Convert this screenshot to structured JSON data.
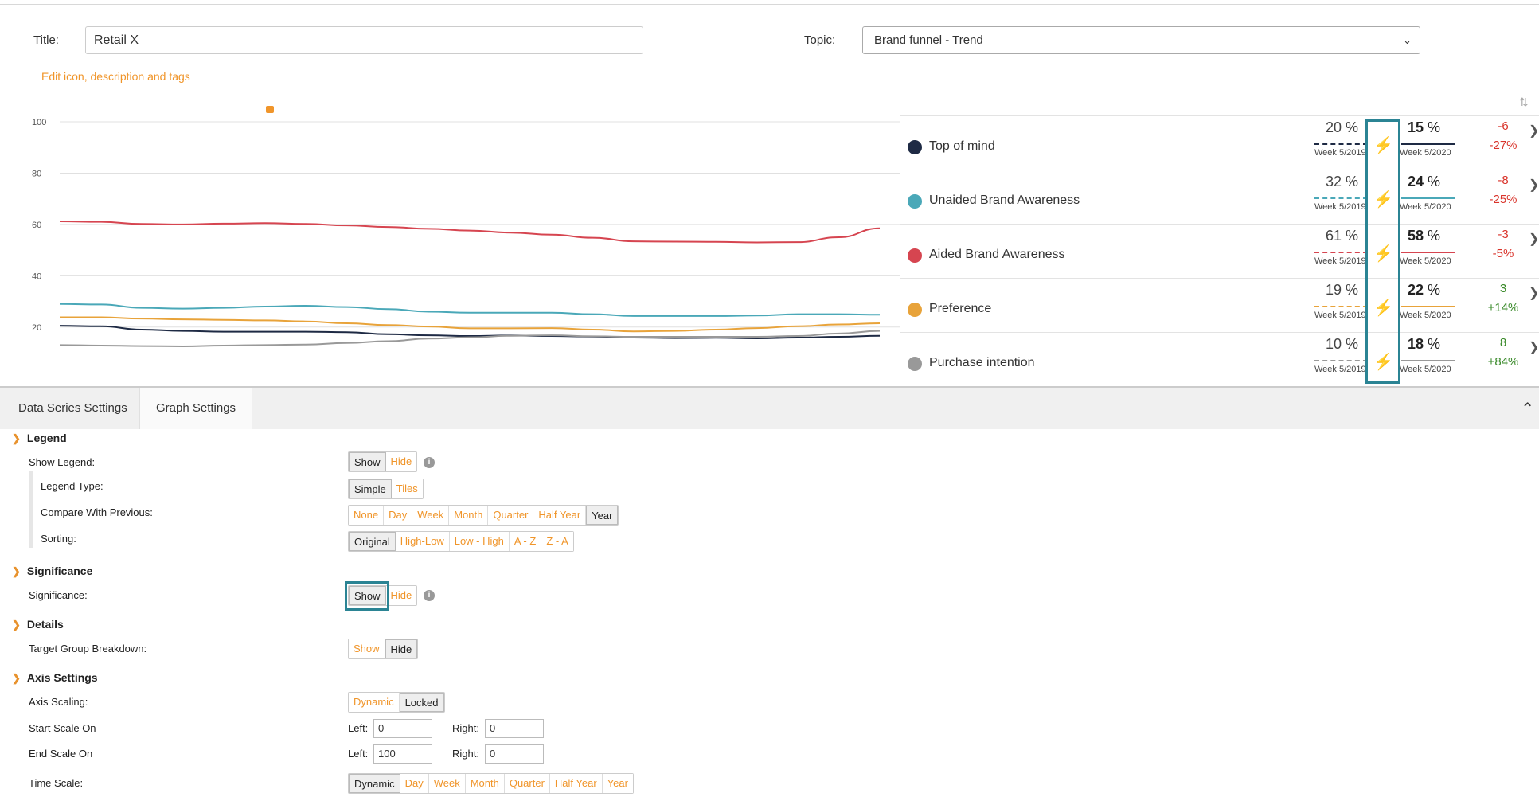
{
  "header": {
    "title_label": "Title:",
    "title_value": "Retail X",
    "topic_label": "Topic:",
    "topic_value": "Brand funnel - Trend",
    "edit_link": "Edit icon, description and tags"
  },
  "chart_data": {
    "type": "line",
    "ylim": [
      10,
      100
    ],
    "yticks": [
      "100",
      "80",
      "60",
      "40",
      "20"
    ],
    "x": [
      0,
      1,
      2,
      3,
      4,
      5,
      6,
      7,
      8,
      9,
      10,
      11,
      12,
      13,
      14,
      15,
      16,
      17,
      18,
      19,
      20
    ],
    "series": [
      {
        "name": "Aided Brand Awareness",
        "color": "#d64550",
        "values": [
          61.2,
          61,
          60.2,
          60,
          60.3,
          60.5,
          60.2,
          59.6,
          59,
          58.3,
          57.6,
          56.8,
          56,
          54.8,
          53.4,
          53.3,
          53.2,
          53,
          53.1,
          55,
          58.5
        ]
      },
      {
        "name": "Unaided Brand Awareness",
        "color": "#4aa8b8",
        "values": [
          29,
          28.8,
          27.5,
          27.2,
          27.5,
          28,
          28.3,
          27.8,
          27,
          26,
          25.6,
          25.6,
          25.6,
          25,
          24.3,
          24.3,
          24.3,
          24.5,
          25,
          25,
          24.8
        ]
      },
      {
        "name": "Preference",
        "color": "#e8a33a",
        "values": [
          23.8,
          23.8,
          23.3,
          23,
          22.8,
          22.6,
          22.2,
          21.5,
          20.8,
          20.2,
          19.5,
          19.5,
          19.6,
          19,
          18.3,
          18.5,
          19,
          19.6,
          20.3,
          21,
          21.5
        ]
      },
      {
        "name": "Top of mind",
        "color": "#1e2a44",
        "values": [
          20.5,
          20.3,
          19,
          18.5,
          18.2,
          18.2,
          18.2,
          18,
          17.2,
          16.8,
          16.5,
          16.7,
          16.5,
          16.3,
          15.9,
          15.7,
          15.8,
          15.6,
          15.9,
          16.2,
          16.6
        ]
      },
      {
        "name": "Purchase intention",
        "color": "#999999",
        "values": [
          13,
          12.8,
          12.6,
          12.5,
          12.8,
          13,
          13.2,
          13.8,
          14.5,
          15.5,
          16,
          16.6,
          16.8,
          16.4,
          16.2,
          16.2,
          16.2,
          16.2,
          16.5,
          17.5,
          18.5
        ]
      }
    ]
  },
  "legend": {
    "rows": [
      {
        "name": "Top of mind",
        "color": "#1e2a44",
        "prev": "20",
        "prev_week": "Week 5/2019",
        "cur": "15",
        "cur_week": "Week 5/2020",
        "sig_color": "#f0952a",
        "d_abs": "-6",
        "d_pct": "-27%",
        "d_color": "#d9342b"
      },
      {
        "name": "Unaided Brand Awareness",
        "color": "#4aa8b8",
        "prev": "32",
        "prev_week": "Week 5/2019",
        "cur": "24",
        "cur_week": "Week 5/2020",
        "sig_color": "#f0952a",
        "d_abs": "-8",
        "d_pct": "-25%",
        "d_color": "#d9342b"
      },
      {
        "name": "Aided Brand Awareness",
        "color": "#d64550",
        "prev": "61",
        "prev_week": "Week 5/2019",
        "cur": "58",
        "cur_week": "Week 5/2020",
        "sig_color": "#e2e2e2",
        "d_abs": "-3",
        "d_pct": "-5%",
        "d_color": "#d9342b"
      },
      {
        "name": "Preference",
        "color": "#e8a33a",
        "prev": "19",
        "prev_week": "Week 5/2019",
        "cur": "22",
        "cur_week": "Week 5/2020",
        "sig_color": "#e2e2e2",
        "d_abs": "3",
        "d_pct": "+14%",
        "d_color": "#3a8a2a"
      },
      {
        "name": "Purchase intention",
        "color": "#999999",
        "prev": "10",
        "prev_week": "Week 5/2019",
        "cur": "18",
        "cur_week": "Week 5/2020",
        "sig_color": "#f0952a",
        "d_abs": "8",
        "d_pct": "+84%",
        "d_color": "#3a8a2a"
      }
    ],
    "pct": "%"
  },
  "tabs": {
    "data_series": "Data Series Settings",
    "graph": "Graph Settings"
  },
  "settings": {
    "legend_section": "Legend",
    "show_legend": "Show Legend:",
    "legend_type": "Legend Type:",
    "compare_with_previous": "Compare With Previous:",
    "sorting": "Sorting:",
    "significance_section": "Significance",
    "significance": "Significance:",
    "details_section": "Details",
    "target_group_breakdown": "Target Group Breakdown:",
    "axis_section": "Axis Settings",
    "axis_scaling": "Axis Scaling:",
    "start_scale_on": "Start Scale On",
    "end_scale_on": "End Scale On",
    "time_scale": "Time Scale:",
    "show": "Show",
    "hide": "Hide",
    "simple": "Simple",
    "tiles": "Tiles",
    "compare_options": [
      "None",
      "Day",
      "Week",
      "Month",
      "Quarter",
      "Half Year",
      "Year"
    ],
    "sort_options": [
      "Original",
      "High-Low",
      "Low - High",
      "A - Z",
      "Z - A"
    ],
    "dynamic": "Dynamic",
    "locked": "Locked",
    "left": "Left:",
    "right": "Right:",
    "start_left": "0",
    "start_right": "0",
    "end_left": "100",
    "end_right": "0",
    "time_options": [
      "Dynamic",
      "Day",
      "Week",
      "Month",
      "Quarter",
      "Half Year",
      "Year"
    ],
    "info": "i"
  }
}
